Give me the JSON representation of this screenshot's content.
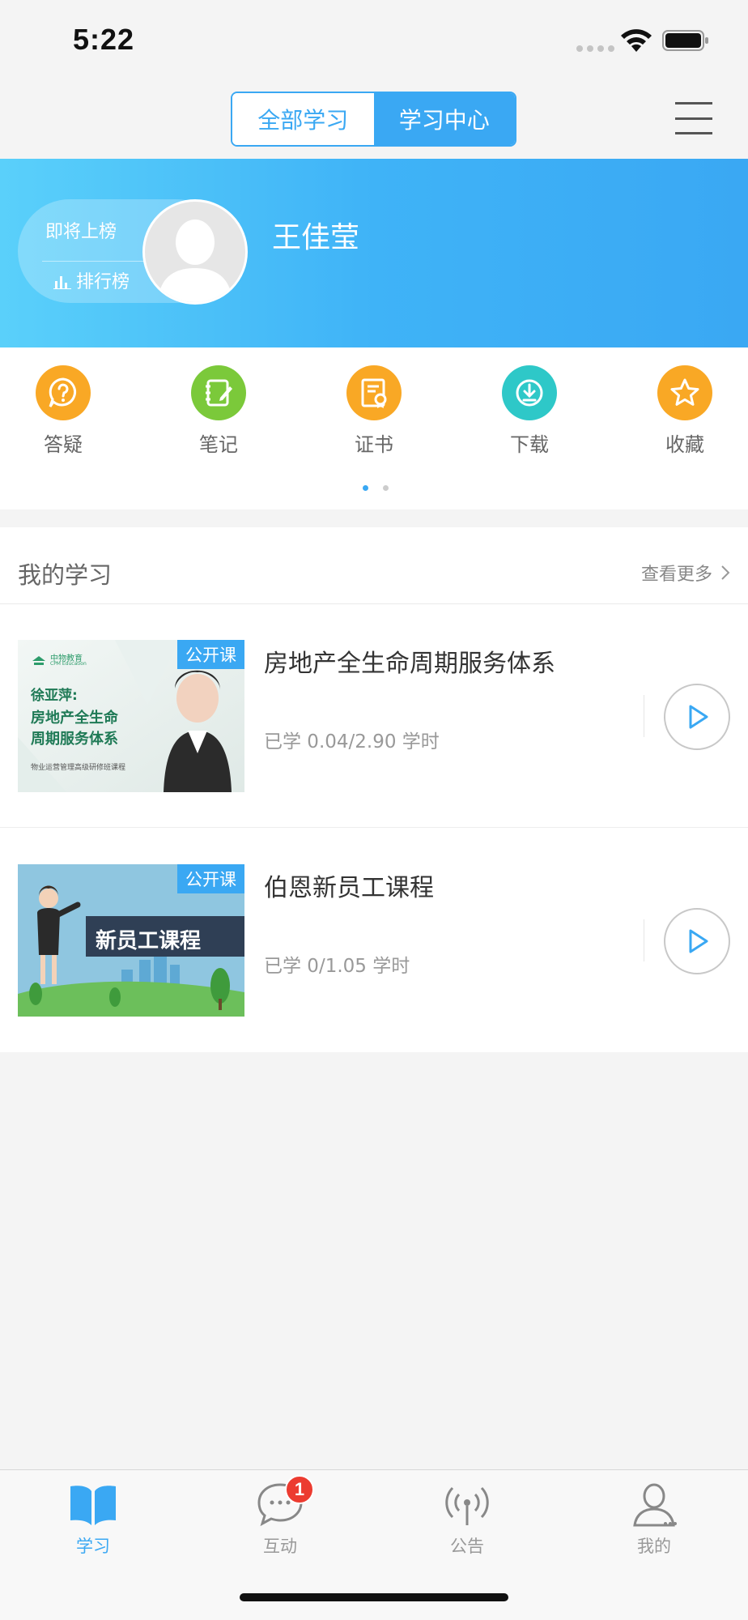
{
  "status_bar": {
    "time": "5:22"
  },
  "nav": {
    "segments": [
      {
        "label": "全部学习",
        "active": false
      },
      {
        "label": "学习中心",
        "active": true
      }
    ],
    "menu_icon": "hamburger-menu-icon"
  },
  "profile": {
    "rank_status": "即将上榜",
    "rank_link": "排行榜",
    "name": "王佳莹"
  },
  "quick_actions": [
    {
      "label": "答疑",
      "icon": "question-chat-icon",
      "color": "#f9a825"
    },
    {
      "label": "笔记",
      "icon": "notebook-pen-icon",
      "color": "#7bc93a"
    },
    {
      "label": "证书",
      "icon": "certificate-icon",
      "color": "#f9a825"
    },
    {
      "label": "下载",
      "icon": "download-icon",
      "color": "#2ec8c8"
    },
    {
      "label": "收藏",
      "icon": "star-icon",
      "color": "#f9a825"
    }
  ],
  "pager": {
    "pages": 2,
    "active": 0
  },
  "my_study": {
    "title": "我的学习",
    "more_label": "查看更多",
    "courses": [
      {
        "title": "房地产全生命周期服务体系",
        "progress": "已学 0.04/2.90 学时",
        "tag": "公开课",
        "thumb": {
          "brand": "中物教育",
          "brand_sub": "CPM Education",
          "lecturer": "徐亚萍:",
          "line1": "房地产全生命",
          "line2": "周期服务体系",
          "caption": "物业运营管理高级研修班课程"
        }
      },
      {
        "title": "伯恩新员工课程",
        "progress": "已学 0/1.05 学时",
        "tag": "公开课",
        "thumb": {
          "banner": "新员工课程"
        }
      }
    ]
  },
  "tabbar": {
    "tabs": [
      {
        "label": "学习",
        "icon": "open-book-icon",
        "active": true
      },
      {
        "label": "互动",
        "icon": "chat-bubble-icon",
        "active": false,
        "badge": "1"
      },
      {
        "label": "公告",
        "icon": "broadcast-icon",
        "active": false
      },
      {
        "label": "我的",
        "icon": "user-profile-icon",
        "active": false
      }
    ]
  },
  "colors": {
    "accent": "#3aa8f3",
    "badge": "#ec3b30"
  }
}
